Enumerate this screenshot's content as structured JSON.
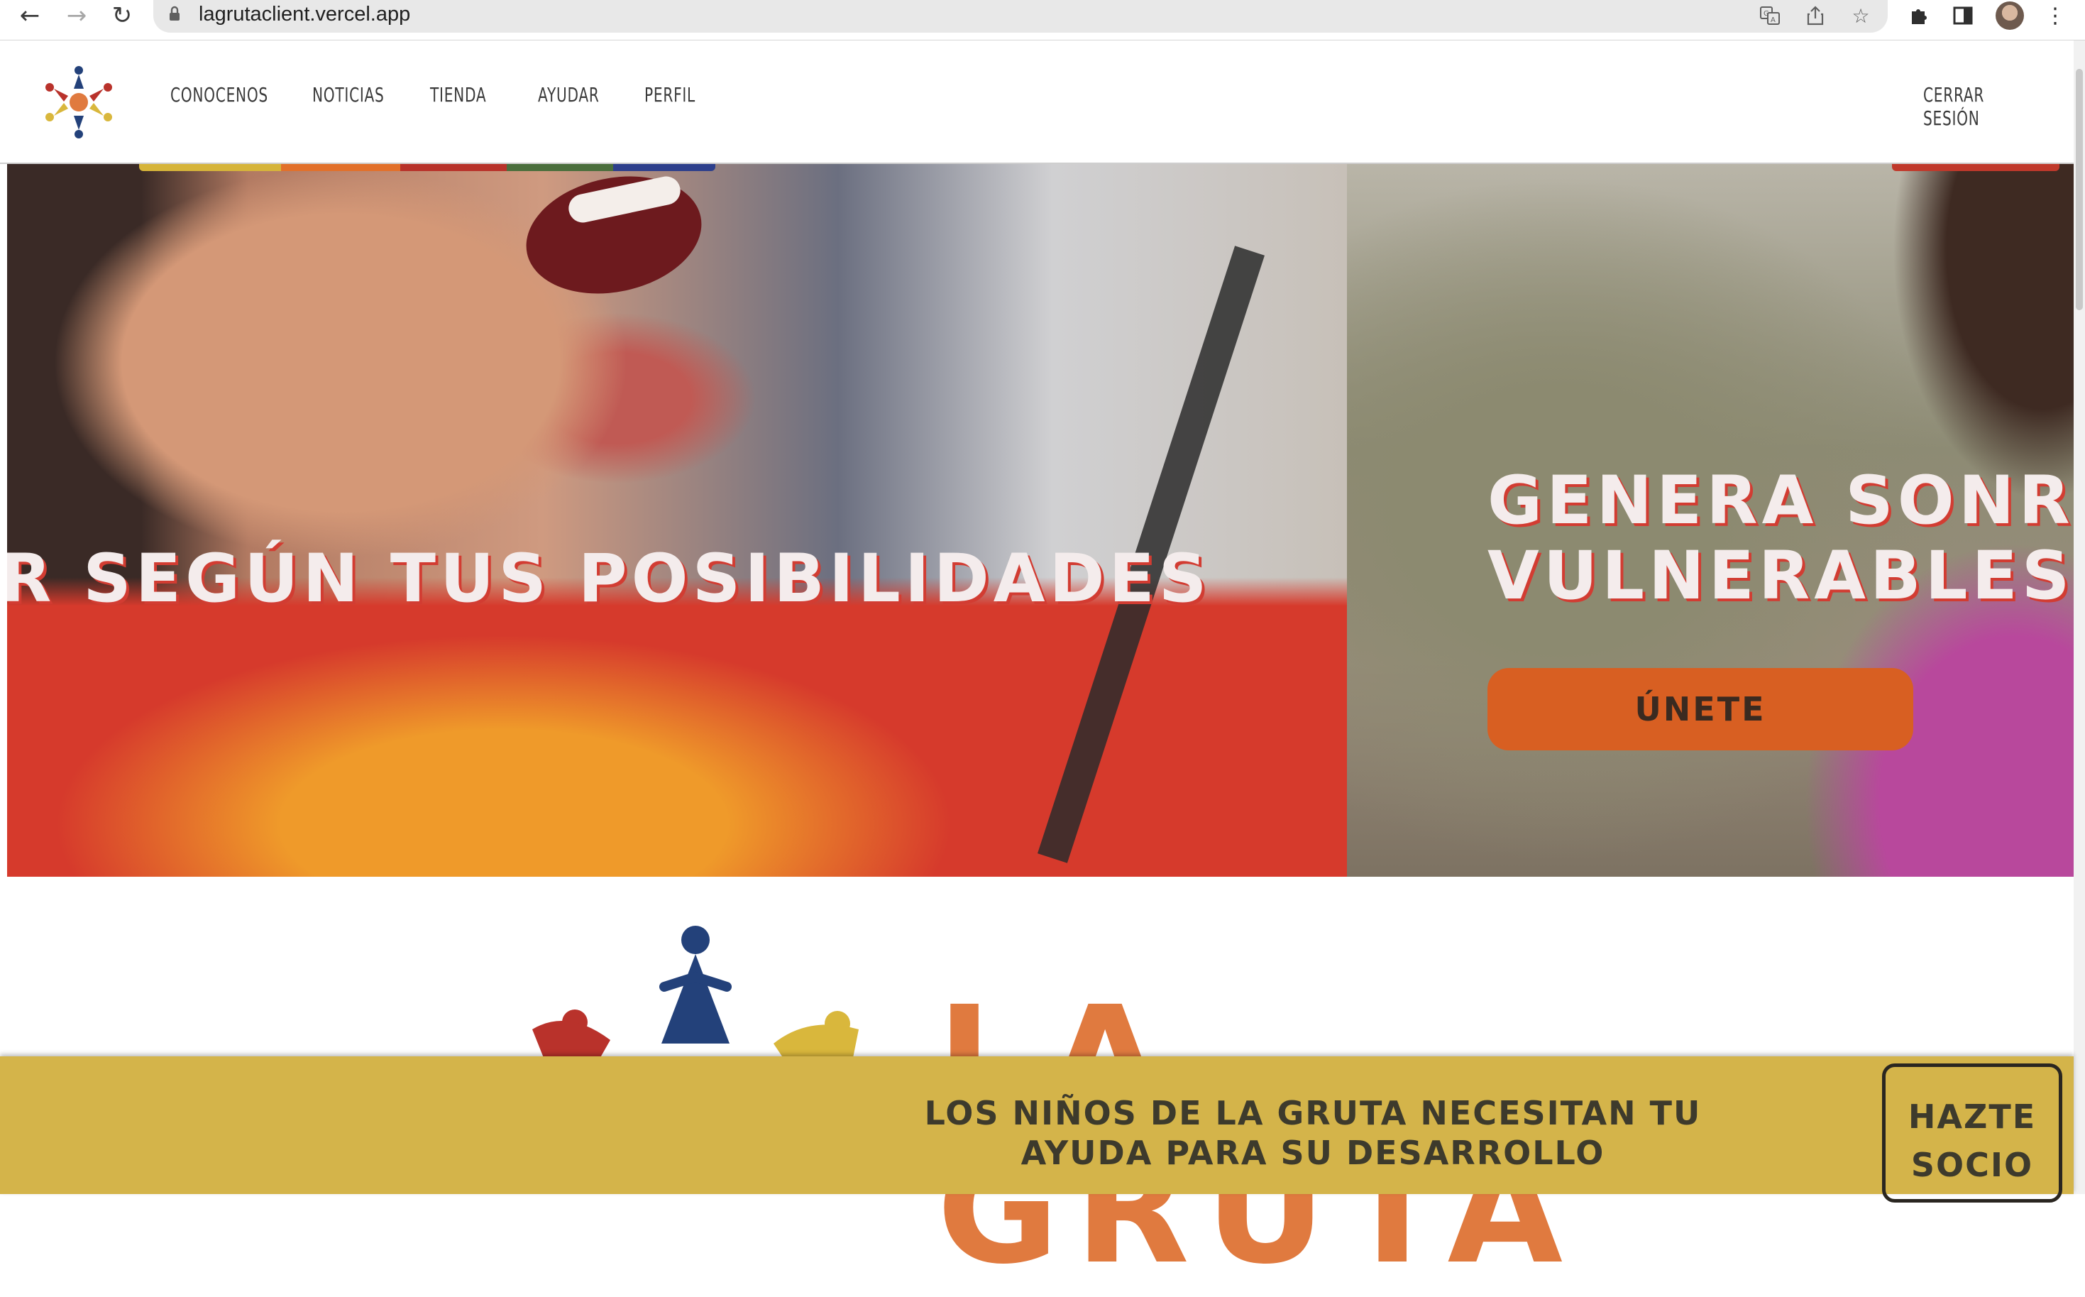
{
  "browser": {
    "url": "lagrutaclient.vercel.app",
    "icons": [
      "back-arrow-icon",
      "forward-arrow-icon",
      "reload-icon",
      "lock-icon",
      "translate-icon",
      "share-icon",
      "bookmark-star-icon",
      "extensions-puzzle-icon",
      "side-panel-icon",
      "profile-avatar",
      "more-menu-icon"
    ]
  },
  "header": {
    "nav": [
      "CONOCENOS",
      "NOTICIAS",
      "TIENDA",
      "AYUDAR",
      "PERFIL"
    ],
    "logout": "CERRAR SESIÓN"
  },
  "hero": {
    "left_heading": "R SEGÚN TUS POSIBILIDADES",
    "right_heading_line1": "GENERA SONRIS",
    "right_heading_line2": "VULNERABLES",
    "join_button": "ÚNETE",
    "progress_colors": [
      "#d6b43a",
      "#e2702a",
      "#b8322a",
      "#4a6e3c",
      "#2d3f8c"
    ],
    "active_indicator_color": "#c0392b"
  },
  "brand": {
    "wordmark": "LA GRUTA",
    "colors": {
      "orange": "#e07a3f",
      "navy": "#23417a",
      "red": "#b9322b",
      "yellow": "#d9b73c"
    }
  },
  "cta": {
    "line1": "LOS NIÑOS DE LA GRUTA NECESITAN TU",
    "line2": "AYUDA PARA SU DESARROLLO",
    "button_line1": "HAZTE",
    "button_line2": "SOCIO",
    "background": "#d4b44a"
  }
}
